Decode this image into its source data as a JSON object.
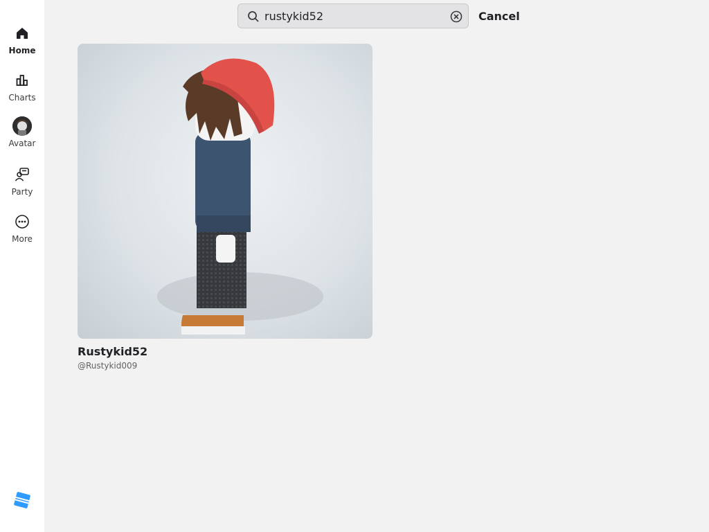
{
  "sidebar": {
    "items": [
      {
        "label": "Home",
        "icon": "home-icon",
        "active": true
      },
      {
        "label": "Charts",
        "icon": "charts-icon",
        "active": false
      },
      {
        "label": "Avatar",
        "icon": "avatar-icon",
        "active": false
      },
      {
        "label": "Party",
        "icon": "party-icon",
        "active": false
      },
      {
        "label": "More",
        "icon": "more-icon",
        "active": false
      }
    ],
    "logo_icon": "roblox-logo-icon"
  },
  "search": {
    "value": "rustykid52",
    "cancel_label": "Cancel"
  },
  "results": [
    {
      "display_name": "Rustykid52",
      "username": "@Rustykid009"
    }
  ],
  "colors": {
    "background": "#f2f2f3",
    "sidebar": "#ffffff",
    "logo": "#2f9bff"
  }
}
